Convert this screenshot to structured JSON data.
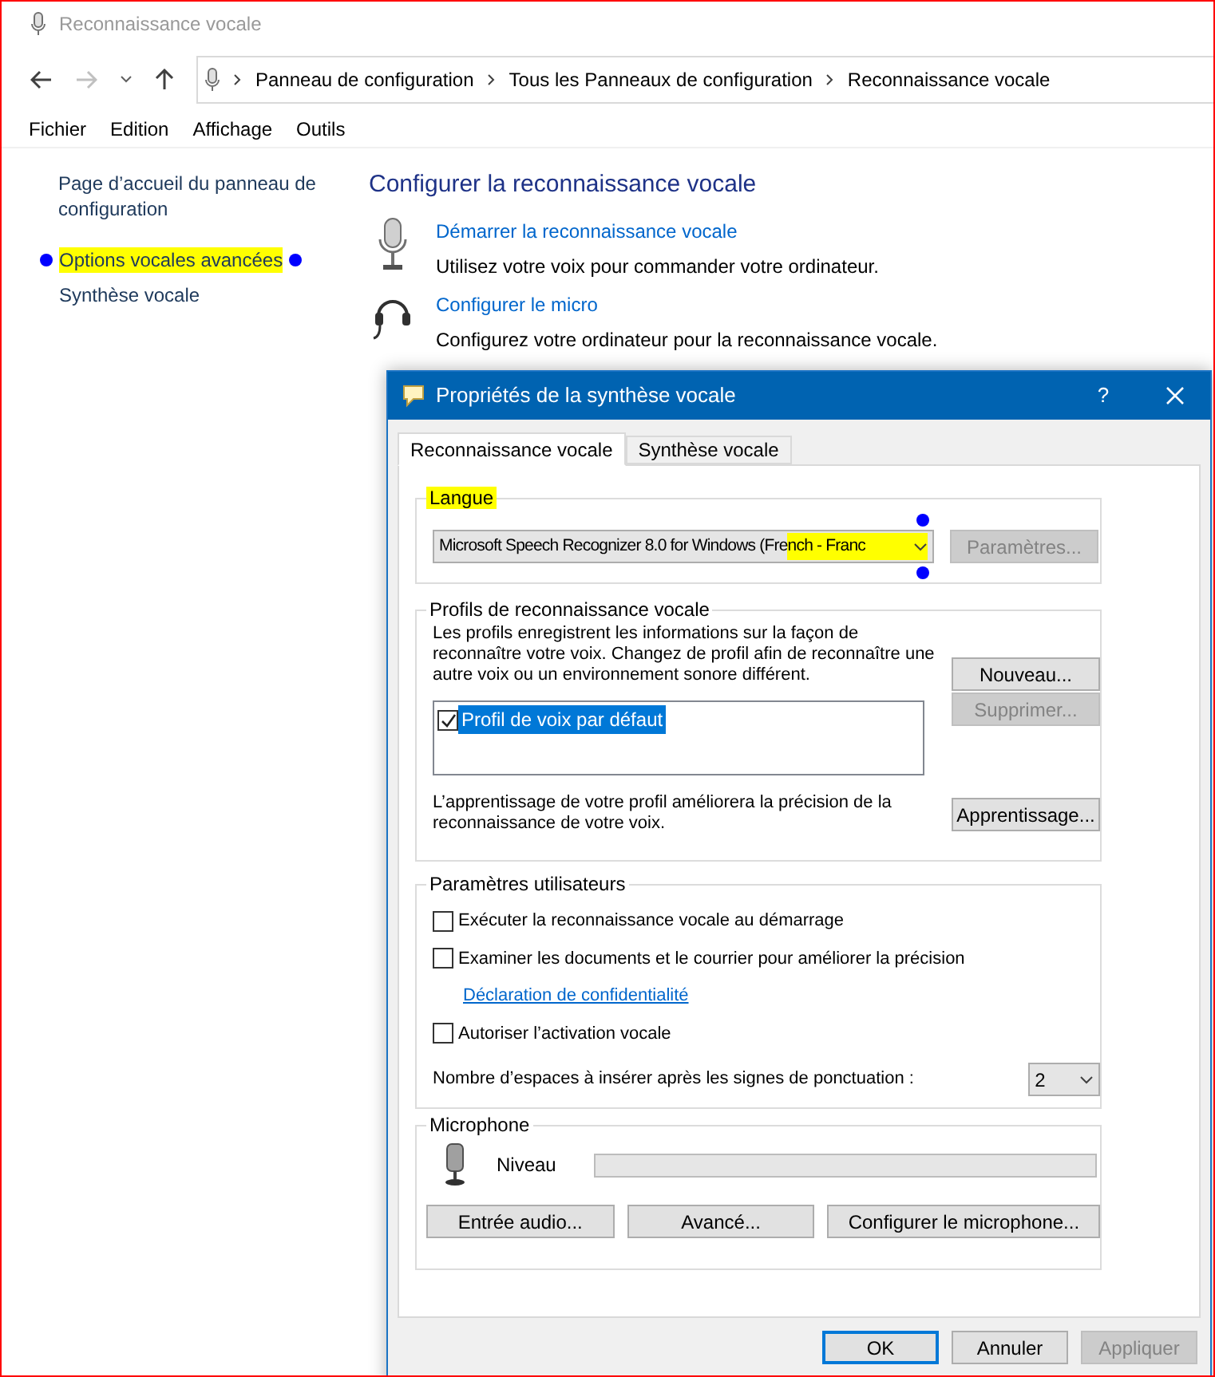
{
  "window": {
    "title": "Reconnaissance vocale"
  },
  "address_bar": {
    "segments": [
      "Panneau de configuration",
      "Tous les Panneaux de configuration",
      "Reconnaissance vocale"
    ]
  },
  "menu": [
    "Fichier",
    "Edition",
    "Affichage",
    "Outils"
  ],
  "sidebar": {
    "items": [
      {
        "label": "Page d’accueil du panneau de configuration",
        "highlighted": false
      },
      {
        "label": "Options vocales avancées",
        "highlighted": true
      },
      {
        "label": "Synthèse vocale",
        "highlighted": false
      }
    ]
  },
  "main": {
    "heading": "Configurer la reconnaissance vocale",
    "tasks": [
      {
        "kind": "microphone",
        "link": "Démarrer la reconnaissance vocale",
        "description": "Utilisez votre voix pour commander votre ordinateur."
      },
      {
        "kind": "headset",
        "link": "Configurer le micro",
        "description": "Configurez votre ordinateur pour la reconnaissance vocale."
      }
    ]
  },
  "dialog": {
    "title": "Propriétés de la synthèse vocale",
    "help": "?",
    "tabs": [
      {
        "label": "Reconnaissance vocale",
        "selected": true
      },
      {
        "label": "Synthèse vocale",
        "selected": false
      }
    ],
    "language": {
      "title": "Langue",
      "highlighted": true,
      "dropdown": {
        "value": "Microsoft Speech Recognizer 8.0 for Windows (French - Franc",
        "highlighted": true
      },
      "settings_button": {
        "label": "Paramètres...",
        "disabled": true
      }
    },
    "profiles": {
      "title": "Profils de reconnaissance vocale",
      "description": "Les profils enregistrent les informations sur la façon de reconnaître votre voix. Changez de profil afin de reconnaître une autre voix ou un environnement sonore différent.",
      "new_button": {
        "label": "Nouveau...",
        "disabled": false
      },
      "items": [
        {
          "label": "Profil de voix par défaut",
          "checked": true,
          "selected": true
        }
      ],
      "delete_button": {
        "label": "Supprimer...",
        "disabled": true
      },
      "training_text": "L’apprentissage de votre profil améliorera la précision de la reconnaissance de votre voix.",
      "training_button": {
        "label": "Apprentissage...",
        "disabled": false
      }
    },
    "user_settings": {
      "title": "Paramètres utilisateurs",
      "options": [
        {
          "kind": "checkbox",
          "label": "Exécuter la reconnaissance vocale au démarrage",
          "checked": false
        },
        {
          "kind": "checkbox",
          "label": "Examiner les documents et le courrier pour améliorer la précision",
          "checked": false
        },
        {
          "kind": "link",
          "label": "Déclaration de confidentialité"
        },
        {
          "kind": "checkbox",
          "label": "Autoriser l’activation vocale",
          "checked": false
        }
      ],
      "spacing": {
        "label": "Nombre d’espaces à insérer après les signes de ponctuation :",
        "value": "2"
      }
    },
    "microphone": {
      "title": "Microphone",
      "level_label": "Niveau",
      "level": 0,
      "buttons": [
        "Entrée audio...",
        "Avancé...",
        "Configurer le microphone..."
      ]
    },
    "footer": [
      {
        "label": "OK",
        "default": true,
        "disabled": false
      },
      {
        "label": "Annuler",
        "default": false,
        "disabled": false
      },
      {
        "label": "Appliquer",
        "default": false,
        "disabled": true
      }
    ]
  }
}
